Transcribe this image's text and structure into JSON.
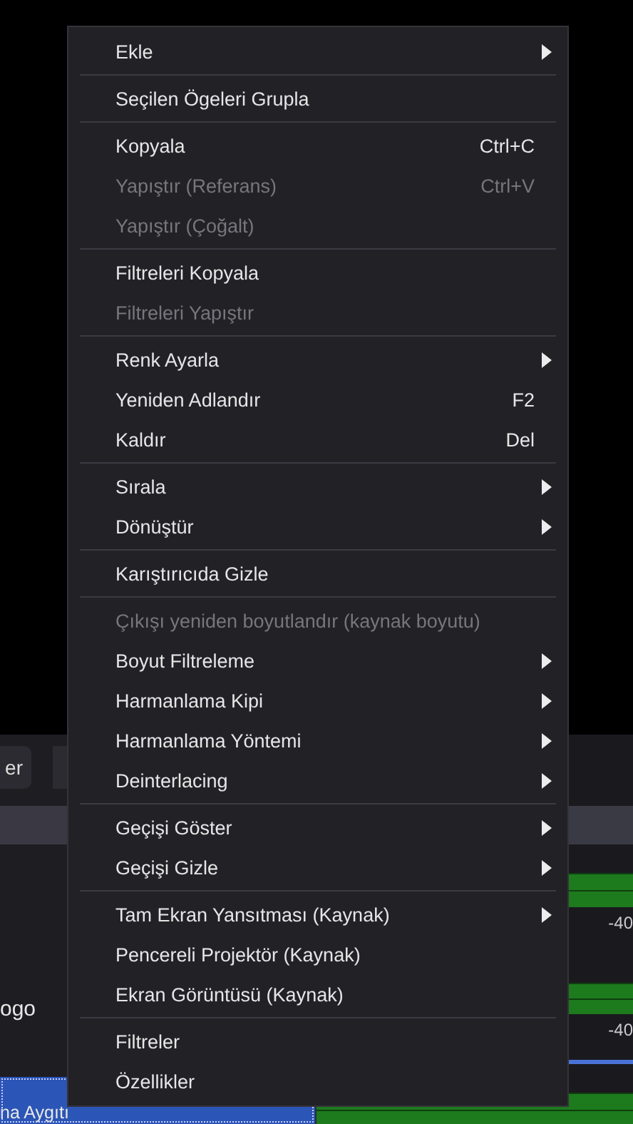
{
  "background": {
    "toolbar_button": "er",
    "list_items": [
      {
        "label": "ogo",
        "selected": false
      },
      {
        "label": "na Aygıtı",
        "selected": true
      }
    ],
    "meters": [
      {
        "scale": "-40",
        "slider": false
      },
      {
        "scale": "-40",
        "slider": true
      }
    ]
  },
  "context_menu": {
    "sections": [
      [
        {
          "label": "Ekle",
          "submenu": true,
          "disabled": false
        }
      ],
      [
        {
          "label": "Seçilen Ögeleri Grupla",
          "submenu": false,
          "disabled": false
        }
      ],
      [
        {
          "label": "Kopyala",
          "shortcut": "Ctrl+C",
          "submenu": false,
          "disabled": false
        },
        {
          "label": "Yapıştır (Referans)",
          "shortcut": "Ctrl+V",
          "submenu": false,
          "disabled": true
        },
        {
          "label": "Yapıştır (Çoğalt)",
          "submenu": false,
          "disabled": true
        }
      ],
      [
        {
          "label": "Filtreleri Kopyala",
          "submenu": false,
          "disabled": false
        },
        {
          "label": "Filtreleri Yapıştır",
          "submenu": false,
          "disabled": true
        }
      ],
      [
        {
          "label": "Renk Ayarla",
          "submenu": true,
          "disabled": false
        },
        {
          "label": "Yeniden Adlandır",
          "shortcut": "F2",
          "submenu": false,
          "disabled": false
        },
        {
          "label": "Kaldır",
          "shortcut": "Del",
          "submenu": false,
          "disabled": false
        }
      ],
      [
        {
          "label": "Sırala",
          "submenu": true,
          "disabled": false
        },
        {
          "label": "Dönüştür",
          "submenu": true,
          "disabled": false
        }
      ],
      [
        {
          "label": "Karıştırıcıda Gizle",
          "submenu": false,
          "disabled": false
        }
      ],
      [
        {
          "label": "Çıkışı yeniden boyutlandır (kaynak boyutu)",
          "submenu": false,
          "disabled": true
        },
        {
          "label": "Boyut Filtreleme",
          "submenu": true,
          "disabled": false
        },
        {
          "label": "Harmanlama Kipi",
          "submenu": true,
          "disabled": false
        },
        {
          "label": "Harmanlama Yöntemi",
          "submenu": true,
          "disabled": false
        },
        {
          "label": "Deinterlacing",
          "submenu": true,
          "disabled": false
        }
      ],
      [
        {
          "label": "Geçişi Göster",
          "submenu": true,
          "disabled": false
        },
        {
          "label": "Geçişi Gizle",
          "submenu": true,
          "disabled": false
        }
      ],
      [
        {
          "label": "Tam Ekran Yansıtması (Kaynak)",
          "submenu": true,
          "disabled": false
        },
        {
          "label": "Pencereli Projektör (Kaynak)",
          "submenu": false,
          "disabled": false
        },
        {
          "label": "Ekran Görüntüsü (Kaynak)",
          "submenu": false,
          "disabled": false
        }
      ],
      [
        {
          "label": "Filtreler",
          "submenu": false,
          "disabled": false
        },
        {
          "label": "Özellikler",
          "submenu": false,
          "disabled": false
        }
      ]
    ]
  }
}
